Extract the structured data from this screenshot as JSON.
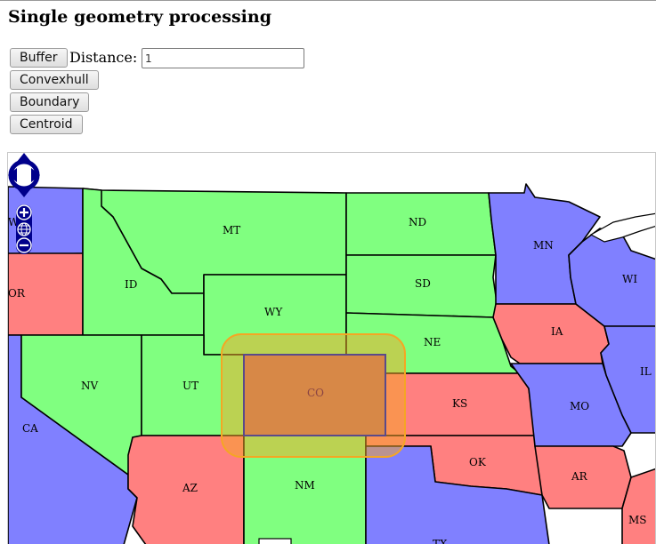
{
  "page": {
    "title": "Single geometry processing"
  },
  "controls": {
    "buffer_label": "Buffer",
    "distance_label": "Distance:",
    "distance_value": "1",
    "convexhull_label": "Convexhull",
    "boundary_label": "Boundary",
    "centroid_label": "Centroid"
  },
  "map": {
    "zoom_controls": {
      "pan_icon": "pan-arrows-icon",
      "zoom_in_icon": "zoom-in-icon",
      "zoom_world_icon": "zoom-world-icon",
      "zoom_out_icon": "zoom-out-icon"
    },
    "colors": {
      "green": "#80ff80",
      "red": "#ff8080",
      "blue": "#8080ff",
      "buffer": "#f5a623",
      "selected": "#b96a6a"
    },
    "selected_state": "CO",
    "states": [
      {
        "abbr": "WA",
        "color": "blue"
      },
      {
        "abbr": "OR",
        "color": "red"
      },
      {
        "abbr": "CA",
        "color": "blue"
      },
      {
        "abbr": "MT",
        "color": "green"
      },
      {
        "abbr": "ID",
        "color": "green"
      },
      {
        "abbr": "WY",
        "color": "green"
      },
      {
        "abbr": "NV",
        "color": "green"
      },
      {
        "abbr": "UT",
        "color": "green"
      },
      {
        "abbr": "AZ",
        "color": "red"
      },
      {
        "abbr": "CO",
        "color": "selected"
      },
      {
        "abbr": "NM",
        "color": "green"
      },
      {
        "abbr": "ND",
        "color": "green"
      },
      {
        "abbr": "SD",
        "color": "green"
      },
      {
        "abbr": "NE",
        "color": "green"
      },
      {
        "abbr": "KS",
        "color": "red"
      },
      {
        "abbr": "OK",
        "color": "red"
      },
      {
        "abbr": "TX",
        "color": "blue"
      },
      {
        "abbr": "MN",
        "color": "blue"
      },
      {
        "abbr": "IA",
        "color": "red"
      },
      {
        "abbr": "MO",
        "color": "blue"
      },
      {
        "abbr": "AR",
        "color": "red"
      },
      {
        "abbr": "WI",
        "color": "blue"
      },
      {
        "abbr": "IL",
        "color": "blue"
      },
      {
        "abbr": "MS",
        "color": "red"
      }
    ]
  }
}
